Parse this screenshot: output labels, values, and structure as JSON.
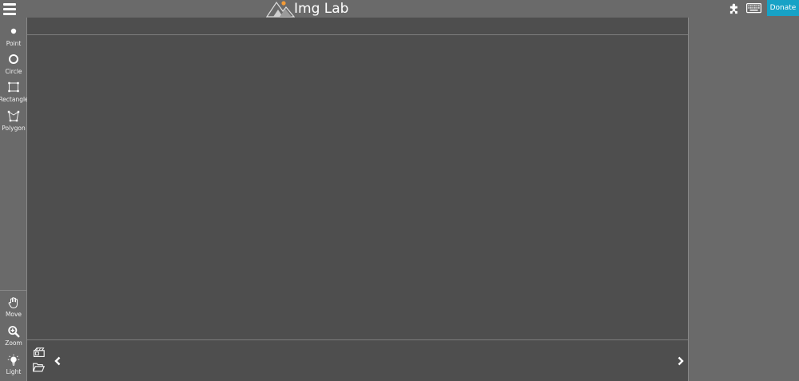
{
  "header": {
    "app_title": "Img Lab",
    "donate_label": "Donate",
    "icons": [
      "menu-icon",
      "logo-icon",
      "puzzle-icon",
      "keyboard-icon"
    ]
  },
  "toolbar": {
    "tools": [
      {
        "label": "Point",
        "icon": "point-icon"
      },
      {
        "label": "Circle",
        "icon": "circle-icon"
      },
      {
        "label": "Rectangle",
        "icon": "rectangle-icon"
      },
      {
        "label": "Polygon",
        "icon": "polygon-icon"
      }
    ],
    "bottom_tools": [
      {
        "label": "Move",
        "icon": "hand-icon"
      },
      {
        "label": "Zoom",
        "icon": "zoom-icon"
      },
      {
        "label": "Light",
        "icon": "light-icon"
      }
    ]
  },
  "filmstrip": {
    "icons": [
      "add-image-icon",
      "open-folder-icon",
      "prev-arrow-icon",
      "next-arrow-icon"
    ]
  },
  "colors": {
    "chrome": "#6a6a6a",
    "canvas": "#4e4e4e",
    "accent": "#17a2c6"
  }
}
